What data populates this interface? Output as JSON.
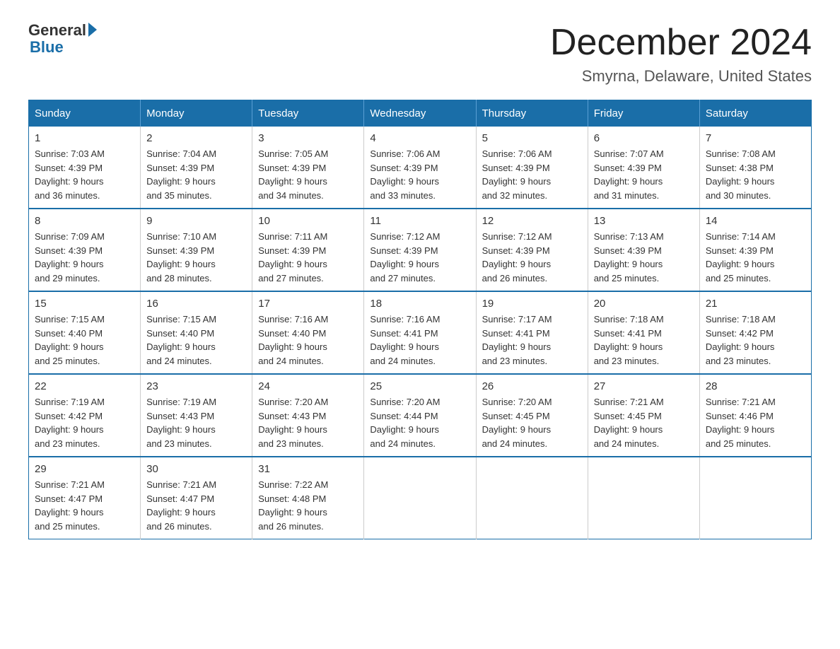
{
  "header": {
    "logo_general": "General",
    "logo_blue": "Blue",
    "month_title": "December 2024",
    "location": "Smyrna, Delaware, United States"
  },
  "weekdays": [
    "Sunday",
    "Monday",
    "Tuesday",
    "Wednesday",
    "Thursday",
    "Friday",
    "Saturday"
  ],
  "weeks": [
    [
      {
        "day": "1",
        "sunrise": "7:03 AM",
        "sunset": "4:39 PM",
        "daylight": "9 hours and 36 minutes."
      },
      {
        "day": "2",
        "sunrise": "7:04 AM",
        "sunset": "4:39 PM",
        "daylight": "9 hours and 35 minutes."
      },
      {
        "day": "3",
        "sunrise": "7:05 AM",
        "sunset": "4:39 PM",
        "daylight": "9 hours and 34 minutes."
      },
      {
        "day": "4",
        "sunrise": "7:06 AM",
        "sunset": "4:39 PM",
        "daylight": "9 hours and 33 minutes."
      },
      {
        "day": "5",
        "sunrise": "7:06 AM",
        "sunset": "4:39 PM",
        "daylight": "9 hours and 32 minutes."
      },
      {
        "day": "6",
        "sunrise": "7:07 AM",
        "sunset": "4:39 PM",
        "daylight": "9 hours and 31 minutes."
      },
      {
        "day": "7",
        "sunrise": "7:08 AM",
        "sunset": "4:38 PM",
        "daylight": "9 hours and 30 minutes."
      }
    ],
    [
      {
        "day": "8",
        "sunrise": "7:09 AM",
        "sunset": "4:39 PM",
        "daylight": "9 hours and 29 minutes."
      },
      {
        "day": "9",
        "sunrise": "7:10 AM",
        "sunset": "4:39 PM",
        "daylight": "9 hours and 28 minutes."
      },
      {
        "day": "10",
        "sunrise": "7:11 AM",
        "sunset": "4:39 PM",
        "daylight": "9 hours and 27 minutes."
      },
      {
        "day": "11",
        "sunrise": "7:12 AM",
        "sunset": "4:39 PM",
        "daylight": "9 hours and 27 minutes."
      },
      {
        "day": "12",
        "sunrise": "7:12 AM",
        "sunset": "4:39 PM",
        "daylight": "9 hours and 26 minutes."
      },
      {
        "day": "13",
        "sunrise": "7:13 AM",
        "sunset": "4:39 PM",
        "daylight": "9 hours and 25 minutes."
      },
      {
        "day": "14",
        "sunrise": "7:14 AM",
        "sunset": "4:39 PM",
        "daylight": "9 hours and 25 minutes."
      }
    ],
    [
      {
        "day": "15",
        "sunrise": "7:15 AM",
        "sunset": "4:40 PM",
        "daylight": "9 hours and 25 minutes."
      },
      {
        "day": "16",
        "sunrise": "7:15 AM",
        "sunset": "4:40 PM",
        "daylight": "9 hours and 24 minutes."
      },
      {
        "day": "17",
        "sunrise": "7:16 AM",
        "sunset": "4:40 PM",
        "daylight": "9 hours and 24 minutes."
      },
      {
        "day": "18",
        "sunrise": "7:16 AM",
        "sunset": "4:41 PM",
        "daylight": "9 hours and 24 minutes."
      },
      {
        "day": "19",
        "sunrise": "7:17 AM",
        "sunset": "4:41 PM",
        "daylight": "9 hours and 23 minutes."
      },
      {
        "day": "20",
        "sunrise": "7:18 AM",
        "sunset": "4:41 PM",
        "daylight": "9 hours and 23 minutes."
      },
      {
        "day": "21",
        "sunrise": "7:18 AM",
        "sunset": "4:42 PM",
        "daylight": "9 hours and 23 minutes."
      }
    ],
    [
      {
        "day": "22",
        "sunrise": "7:19 AM",
        "sunset": "4:42 PM",
        "daylight": "9 hours and 23 minutes."
      },
      {
        "day": "23",
        "sunrise": "7:19 AM",
        "sunset": "4:43 PM",
        "daylight": "9 hours and 23 minutes."
      },
      {
        "day": "24",
        "sunrise": "7:20 AM",
        "sunset": "4:43 PM",
        "daylight": "9 hours and 23 minutes."
      },
      {
        "day": "25",
        "sunrise": "7:20 AM",
        "sunset": "4:44 PM",
        "daylight": "9 hours and 24 minutes."
      },
      {
        "day": "26",
        "sunrise": "7:20 AM",
        "sunset": "4:45 PM",
        "daylight": "9 hours and 24 minutes."
      },
      {
        "day": "27",
        "sunrise": "7:21 AM",
        "sunset": "4:45 PM",
        "daylight": "9 hours and 24 minutes."
      },
      {
        "day": "28",
        "sunrise": "7:21 AM",
        "sunset": "4:46 PM",
        "daylight": "9 hours and 25 minutes."
      }
    ],
    [
      {
        "day": "29",
        "sunrise": "7:21 AM",
        "sunset": "4:47 PM",
        "daylight": "9 hours and 25 minutes."
      },
      {
        "day": "30",
        "sunrise": "7:21 AM",
        "sunset": "4:47 PM",
        "daylight": "9 hours and 26 minutes."
      },
      {
        "day": "31",
        "sunrise": "7:22 AM",
        "sunset": "4:48 PM",
        "daylight": "9 hours and 26 minutes."
      },
      null,
      null,
      null,
      null
    ]
  ],
  "labels": {
    "sunrise": "Sunrise:",
    "sunset": "Sunset:",
    "daylight": "Daylight:"
  }
}
